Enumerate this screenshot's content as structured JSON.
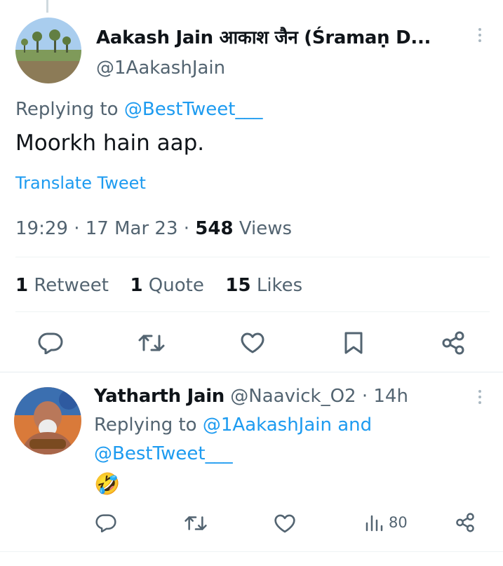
{
  "main_tweet": {
    "author_name": "Aakash Jain आकाश जैन (Śramaṇ D...",
    "author_handle": "@1AakashJain",
    "reply_prefix": "Replying to",
    "reply_to": "@BestTweet___",
    "text": "Moorkh hain aap.",
    "translate_label": "Translate Tweet",
    "time": "19:29",
    "sep1": "·",
    "date": "17 Mar 23",
    "sep2": "·",
    "views_count": "548",
    "views_label": "Views",
    "retweets_count": "1",
    "retweets_label": "Retweet",
    "quotes_count": "1",
    "quotes_label": "Quote",
    "likes_count": "15",
    "likes_label": "Likes"
  },
  "reply": {
    "author_name": "Yatharth Jain",
    "author_handle": "@Naavick_O2",
    "sep": "·",
    "time_ago": "14h",
    "reply_prefix": "Replying to",
    "reply_to_1": "@1AakashJain",
    "reply_and": "and",
    "reply_to_2": "@BestTweet___",
    "emoji": "🤣",
    "views_count": "80"
  },
  "colors": {
    "link": "#1d9bf0",
    "secondary_text": "#536471",
    "divider": "#eff3f4"
  },
  "icons": [
    "reply-icon",
    "retweet-icon",
    "like-icon",
    "bookmark-icon",
    "share-icon",
    "views-icon",
    "more-icon"
  ]
}
